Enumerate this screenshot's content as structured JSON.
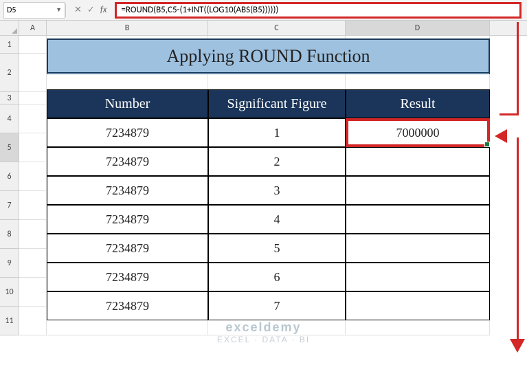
{
  "nameBox": "D5",
  "formula": "=ROUND(B5,C5-(1+INT((LOG10(ABS(B5))))))",
  "columns": [
    "A",
    "B",
    "C",
    "D"
  ],
  "rows": [
    "1",
    "2",
    "3",
    "4",
    "5",
    "6",
    "7",
    "8",
    "9",
    "10",
    "11"
  ],
  "title": "Applying ROUND Function",
  "headers": {
    "number": "Number",
    "sigfig": "Significant Figure",
    "result": "Result"
  },
  "data": [
    {
      "number": "7234879",
      "sigfig": "1",
      "result": "7000000"
    },
    {
      "number": "7234879",
      "sigfig": "2",
      "result": ""
    },
    {
      "number": "7234879",
      "sigfig": "3",
      "result": ""
    },
    {
      "number": "7234879",
      "sigfig": "4",
      "result": ""
    },
    {
      "number": "7234879",
      "sigfig": "5",
      "result": ""
    },
    {
      "number": "7234879",
      "sigfig": "6",
      "result": ""
    },
    {
      "number": "7234879",
      "sigfig": "7",
      "result": ""
    }
  ],
  "watermark": {
    "brand": "exceldemy",
    "tagline": "EXCEL · DATA · BI"
  },
  "icons": {
    "cancel": "✕",
    "confirm": "✓",
    "fx": "fx",
    "dropdown": "▼"
  }
}
